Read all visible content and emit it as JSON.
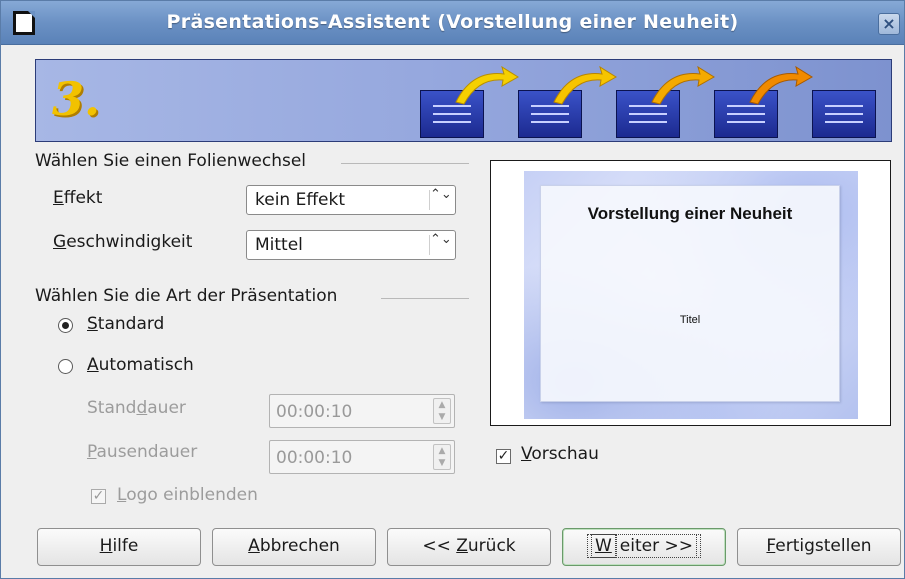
{
  "window": {
    "title": "Präsentations-Assistent (Vorstellung einer Neuheit)",
    "close_symbol": "×"
  },
  "banner": {
    "step": "3.",
    "colors": {
      "step": "#f2c200",
      "slide": "#2a3cb0",
      "arrow_yellow": "#f5d000",
      "arrow_orange": "#f08a00"
    }
  },
  "transition": {
    "heading": "Wählen Sie einen Folienwechsel",
    "effect_label_u": "E",
    "effect_label_rest": "ffekt",
    "effect_value": "kein Effekt",
    "speed_label_u": "G",
    "speed_label_rest": "eschwindigkeit",
    "speed_value": "Mittel",
    "spin_symbol": "⌃⌄"
  },
  "presentation_type": {
    "heading": "Wählen Sie die Art der Präsentation",
    "standard_u": "S",
    "standard_rest": "tandard",
    "automatic_u": "A",
    "automatic_rest": "utomatisch",
    "duration_pre": "Stand",
    "duration_u": "d",
    "duration_post": "auer",
    "duration_value": "00:00:10",
    "pause_u": "P",
    "pause_rest": "ausendauer",
    "pause_value": "00:00:10",
    "logo_u": "L",
    "logo_rest": "ogo einblenden",
    "selected": "standard"
  },
  "preview": {
    "slide_title": "Vorstellung einer Neuheit",
    "slide_subtitle": "Titel",
    "checkbox_u": "V",
    "checkbox_rest": "orschau",
    "checked": true
  },
  "buttons": {
    "help_u": "H",
    "help_rest": "ilfe",
    "cancel_u": "A",
    "cancel_rest": "bbrechen",
    "back_pre": "<< ",
    "back_u": "Z",
    "back_rest": "urück",
    "next_u": "W",
    "next_rest": "eiter >>",
    "finish_u": "F",
    "finish_rest": "ertigstellen"
  }
}
